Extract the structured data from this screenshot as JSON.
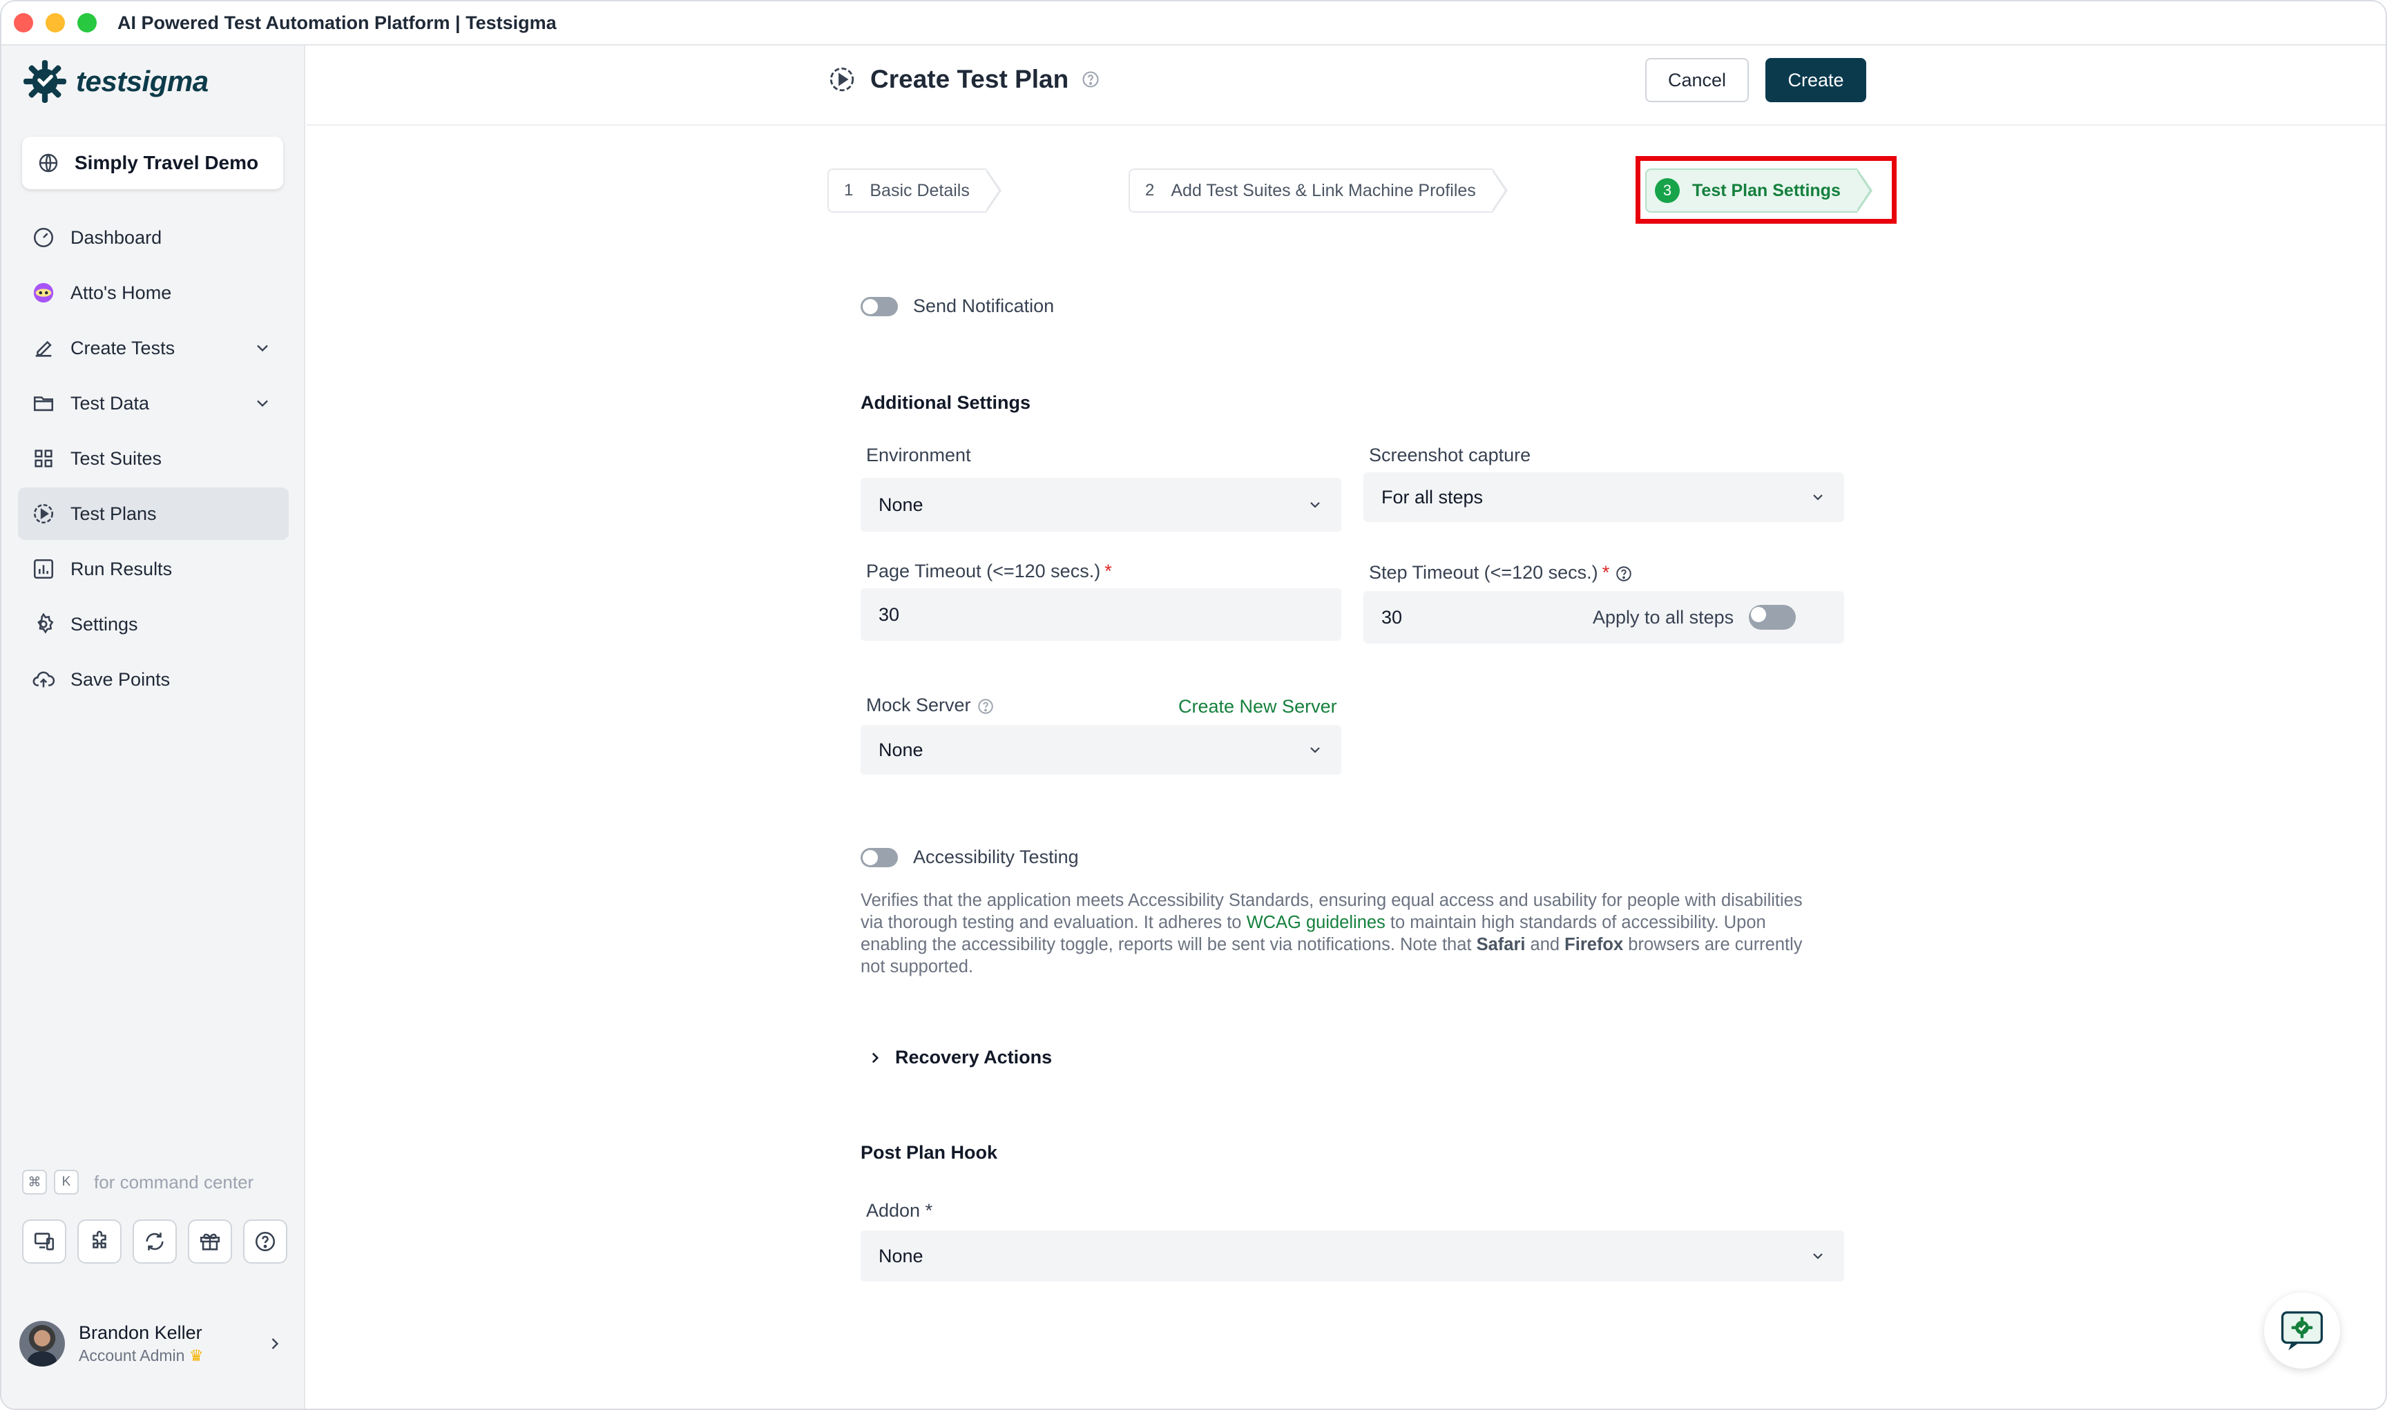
{
  "window": {
    "title": "AI Powered Test Automation Platform | Testsigma"
  },
  "brand": {
    "name": "testsigma",
    "color": "#0d3b4a",
    "accent": "#15803d"
  },
  "sidebar": {
    "project": "Simply Travel Demo",
    "items": [
      {
        "label": "Dashboard",
        "icon": "gauge-icon"
      },
      {
        "label": "Atto's Home",
        "icon": "atto-icon"
      },
      {
        "label": "Create Tests",
        "icon": "pencil-icon"
      },
      {
        "label": "Test Data",
        "icon": "folder-icon"
      },
      {
        "label": "Test Suites",
        "icon": "grid-icon"
      },
      {
        "label": "Test Plans",
        "icon": "play-circle-icon",
        "active": true
      },
      {
        "label": "Run Results",
        "icon": "bar-chart-icon"
      },
      {
        "label": "Settings",
        "icon": "gear-icon"
      },
      {
        "label": "Save Points",
        "icon": "cloud-upload-icon"
      }
    ],
    "command": {
      "key1": "⌘",
      "key2": "K",
      "text": "for command center"
    },
    "user": {
      "name": "Brandon Keller",
      "role": "Account Admin"
    }
  },
  "header": {
    "title": "Create Test Plan",
    "cancel_label": "Cancel",
    "create_label": "Create"
  },
  "steps": [
    {
      "num": "1",
      "label": "Basic Details"
    },
    {
      "num": "2",
      "label": "Add Test Suites & Link Machine Profiles"
    },
    {
      "num": "3",
      "label": "Test Plan Settings",
      "active": true
    }
  ],
  "form": {
    "send_notification": "Send Notification",
    "additional_settings": "Additional Settings",
    "environment": {
      "label": "Environment",
      "value": "None"
    },
    "screenshot": {
      "label": "Screenshot capture",
      "value": "For all steps"
    },
    "page_timeout": {
      "label": "Page Timeout (<=120 secs.)",
      "value": "30"
    },
    "step_timeout": {
      "label": "Step Timeout (<=120 secs.)",
      "value": "30",
      "apply_all": "Apply to all steps"
    },
    "mock_server": {
      "label": "Mock Server",
      "link": "Create New Server",
      "value": "None"
    },
    "accessibility": {
      "label": "Accessibility Testing",
      "desc_part1": "Verifies that the application meets Accessibility Standards, ensuring equal access and usability for people with disabilities via thorough testing and evaluation. It adheres to ",
      "desc_link": "WCAG guidelines",
      "desc_part2": " to maintain high standards of accessibility. Upon enabling the accessibility toggle, reports will be sent via notifications. Note that ",
      "desc_safari": "Safari",
      "desc_and": " and ",
      "desc_firefox": "Firefox",
      "desc_part3": " browsers are currently not supported."
    },
    "recovery_actions": "Recovery Actions",
    "post_plan_hook": "Post Plan Hook",
    "addon": {
      "label": "Addon *",
      "value": "None"
    }
  }
}
